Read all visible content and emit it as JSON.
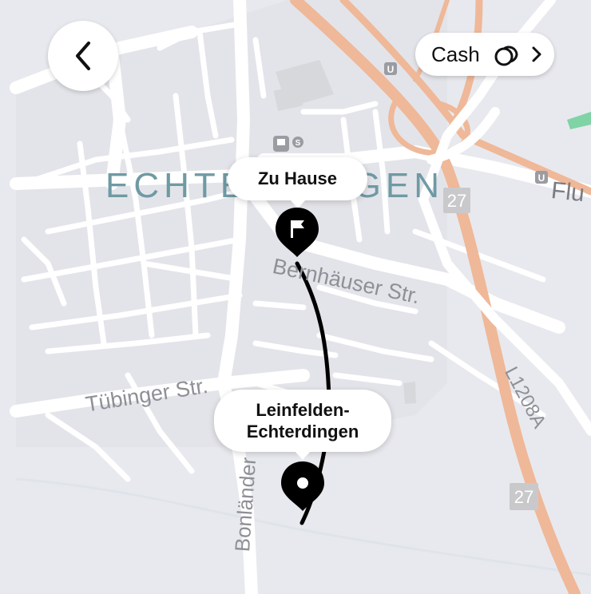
{
  "map": {
    "district_label": "ECHTERDINGEN",
    "street_labels": {
      "bernhaeuser": "Bernhäuser Str.",
      "tuebinger": "Tübinger Str.",
      "bonlaender": "Bonländer",
      "l1208a": "L1208A",
      "flu": "Flu"
    },
    "road_numbers": {
      "b27_top": "27",
      "b27_bottom": "27"
    },
    "transit": {
      "u_badge": "U",
      "s_badge": "S"
    }
  },
  "header": {
    "back_icon": "chevron-left-icon"
  },
  "payment": {
    "label": "Cash",
    "icon": "cash-coins-icon",
    "arrow_icon": "chevron-right-icon"
  },
  "route": {
    "destination_label": "Zu Hause",
    "destination_icon": "flag-icon",
    "origin_label_line1": "Leinfelden-",
    "origin_label_line2": "Echterdingen",
    "origin_icon": "location-pin-icon",
    "route_color": "#000000"
  },
  "colors": {
    "highway": "#efb898",
    "map_bg": "#e8e9ee",
    "street": "#ffffff",
    "block": "#d9d9dd"
  }
}
